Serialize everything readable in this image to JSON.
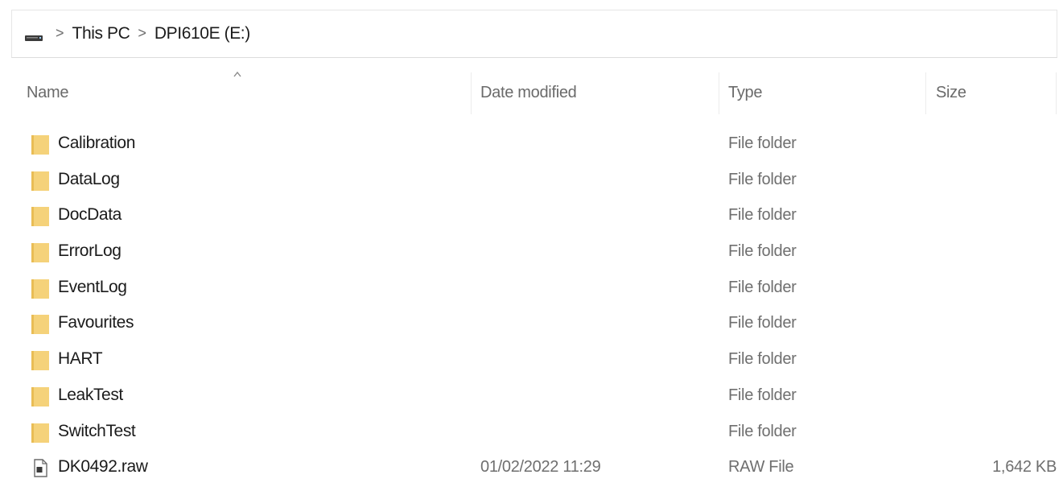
{
  "address_bar": {
    "drive_icon": "drive-icon",
    "separator": ">",
    "crumbs": [
      "This PC",
      "DPI610E (E:)"
    ]
  },
  "columns": {
    "name": "Name",
    "date_modified": "Date modified",
    "type": "Type",
    "size": "Size",
    "sort_indicator": "chevron-up-icon"
  },
  "files": [
    {
      "icon": "folder-icon",
      "name": "Calibration",
      "date": "",
      "type": "File folder",
      "size": ""
    },
    {
      "icon": "folder-icon",
      "name": "DataLog",
      "date": "",
      "type": "File folder",
      "size": ""
    },
    {
      "icon": "folder-icon",
      "name": "DocData",
      "date": "",
      "type": "File folder",
      "size": ""
    },
    {
      "icon": "folder-icon",
      "name": "ErrorLog",
      "date": "",
      "type": "File folder",
      "size": ""
    },
    {
      "icon": "folder-icon",
      "name": "EventLog",
      "date": "",
      "type": "File folder",
      "size": ""
    },
    {
      "icon": "folder-icon",
      "name": "Favourites",
      "date": "",
      "type": "File folder",
      "size": ""
    },
    {
      "icon": "folder-icon",
      "name": "HART",
      "date": "",
      "type": "File folder",
      "size": ""
    },
    {
      "icon": "folder-icon",
      "name": "LeakTest",
      "date": "",
      "type": "File folder",
      "size": ""
    },
    {
      "icon": "folder-icon",
      "name": "SwitchTest",
      "date": "",
      "type": "File folder",
      "size": ""
    },
    {
      "icon": "file-icon",
      "name": "DK0492.raw",
      "date": "01/02/2022 11:29",
      "type": "RAW File",
      "size": "1,642 KB"
    }
  ],
  "colors": {
    "folder_fill": "#f5d27a",
    "folder_tab": "#e9bd55",
    "text_primary": "#1b1b1b",
    "text_secondary": "#6f6f6f"
  }
}
